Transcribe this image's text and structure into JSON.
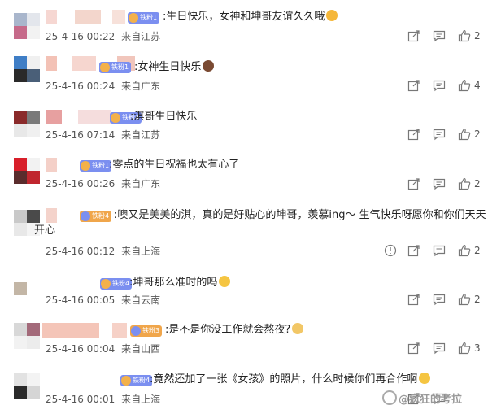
{
  "comments": [
    {
      "text": ":生日快乐，女神和坤哥友谊久久哦",
      "badge": "铁粉1",
      "time": "25-4-16 00:22",
      "location": "来自江苏",
      "likes": "2"
    },
    {
      "text": ":女神生日快乐",
      "badge": "铁粉1",
      "time": "25-4-16 00:24",
      "location": "来自广东",
      "likes": "4"
    },
    {
      "text": ":淇哥生日快乐",
      "badge": "铁粉4",
      "time": "25-4-16 07:14",
      "location": "来自江苏",
      "likes": "2"
    },
    {
      "text": ":零点的生日祝福也太有心了",
      "badge": "铁粉1",
      "time": "25-4-16 00:26",
      "location": "来自广东",
      "likes": "2"
    },
    {
      "text": ":噢又是美美的淇，真的是好贴心的坤哥，羡慕ing～ 生气快乐呀愿你和你们天天",
      "text2": "开心",
      "badge": "铁粉4",
      "time": "25-4-16 00:12",
      "location": "来自上海",
      "likes": "2"
    },
    {
      "text": ":坤哥那么准时的吗",
      "badge": "铁粉4",
      "time": "25-4-16 00:05",
      "location": "来自云南",
      "likes": "2"
    },
    {
      "text": ":是不是你没工作就会熬夜?",
      "badge": "铁粉3",
      "time": "25-4-16 00:04",
      "location": "来自山西",
      "likes": "3"
    },
    {
      "text": ":竟然还加了一张《女孩》的照片，什么时候你们再合作啊",
      "badge": "铁粉4",
      "time": "25-4-16 00:01",
      "location": "来自上海",
      "likes": ""
    }
  ],
  "watermark": "@疯狂的考拉",
  "colors": {
    "badge": "#7b8ff0",
    "badge_alt": "#f0a64b",
    "icon": "#777777",
    "text": "#222222",
    "meta": "#555555"
  },
  "icons": {
    "share": "share-icon",
    "comment": "comment-icon",
    "like": "thumbs-up-icon",
    "report": "report-icon"
  }
}
